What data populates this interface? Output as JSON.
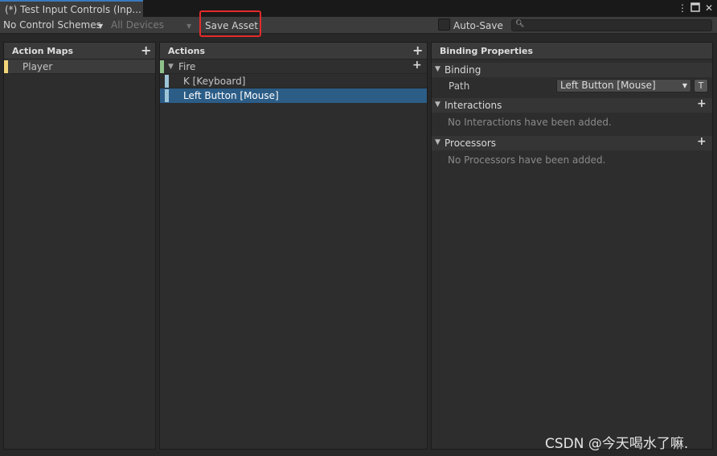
{
  "window": {
    "tab_title": "(*) Test Input Controls (Inp...",
    "menu_icon": "kebab-menu-icon",
    "maximize_icon": "maximize-icon",
    "close_icon": "close-icon"
  },
  "toolbar": {
    "control_schemes": "No Control Schemes",
    "devices": "All Devices",
    "save_label": "Save Asset",
    "autosave_label": "Auto-Save",
    "autosave_checked": false,
    "search_value": "",
    "highlight_color": "#e52a2a"
  },
  "action_maps": {
    "header": "Action Maps",
    "items": [
      {
        "label": "Player",
        "color": "#f2d678"
      }
    ]
  },
  "actions": {
    "header": "Actions",
    "items": [
      {
        "label": "Fire",
        "color": "#8fc08a",
        "bindings": [
          {
            "label": "K [Keyboard]",
            "color": "#9ec4d8",
            "selected": false
          },
          {
            "label": "Left Button [Mouse]",
            "color": "#9ec4d8",
            "selected": true
          }
        ]
      }
    ]
  },
  "binding_properties": {
    "header": "Binding Properties",
    "binding_section": "Binding",
    "path_label": "Path",
    "path_value": "Left Button [Mouse]",
    "t_button": "T",
    "interactions_section": "Interactions",
    "interactions_empty": "No Interactions have been added.",
    "processors_section": "Processors",
    "processors_empty": "No Processors have been added."
  },
  "watermark": "CSDN @今天喝水了嘛.",
  "colors": {
    "selected_row": "#2c5d87",
    "tab_accent": "#3a79bb"
  }
}
